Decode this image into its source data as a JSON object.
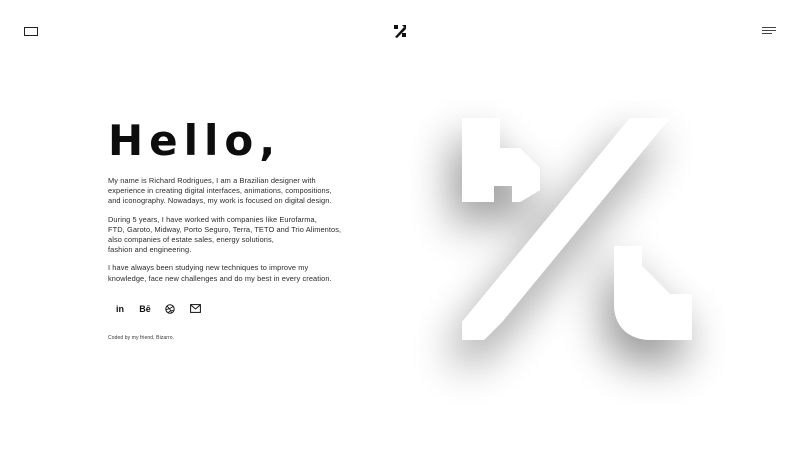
{
  "header": {
    "left_icon": "rectangle-outline-icon",
    "logo_icon": "percent-logo-icon",
    "menu_icon": "hamburger-menu-icon"
  },
  "main": {
    "greeting": "Hello,",
    "paragraphs": [
      {
        "lines": [
          "My name is Richard Rodrigues, I am a Brazilian designer with",
          "experience in creating digital interfaces, animations, compositions,",
          "and iconography. Nowadays, my work is focused on digital design."
        ]
      },
      {
        "lines": [
          "During 5 years, I have worked with companies like Eurofarma,",
          "FTD, Garoto, Midway, Porto Seguro, Terra, TETO and Trio Alimentos,",
          "also companies of estate sales, energy solutions,",
          "fashion and engineering."
        ]
      },
      {
        "lines": [
          "I have always been studying new techniques to improve my",
          "knowledge, face new challenges and do my best in every creation."
        ]
      }
    ],
    "socials": [
      {
        "name": "linkedin",
        "icon": "linkedin-icon",
        "label": "in"
      },
      {
        "name": "behance",
        "icon": "behance-icon",
        "label": "Bē"
      },
      {
        "name": "dribbble",
        "icon": "dribbble-icon"
      },
      {
        "name": "email",
        "icon": "mail-icon"
      }
    ],
    "credit": "Coded by my friend, Bizarro."
  },
  "hero": {
    "icon": "rr-monogram-logo-icon",
    "colors": {
      "background": "#ffffff",
      "shape": "#ffffff",
      "shadow": "#9a9a9a"
    }
  }
}
